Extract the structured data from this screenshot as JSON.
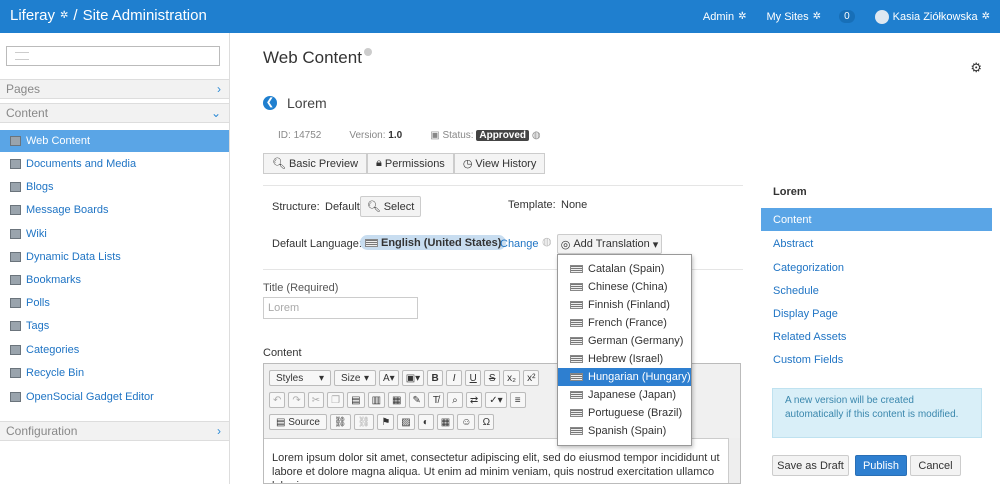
{
  "topbar": {
    "brand": "Liferay",
    "separator": "/",
    "section": "Site Administration",
    "admin": "Admin",
    "my_sites": "My Sites",
    "notifications": "0",
    "user": "Kasia Ziółkowska"
  },
  "sidebar": {
    "pages": "Pages",
    "content": "Content",
    "configuration": "Configuration",
    "items": [
      {
        "label": "Web Content"
      },
      {
        "label": "Documents and Media"
      },
      {
        "label": "Blogs"
      },
      {
        "label": "Message Boards"
      },
      {
        "label": "Wiki"
      },
      {
        "label": "Dynamic Data Lists"
      },
      {
        "label": "Bookmarks"
      },
      {
        "label": "Polls"
      },
      {
        "label": "Tags"
      },
      {
        "label": "Categories"
      },
      {
        "label": "Recycle Bin"
      },
      {
        "label": "OpenSocial Gadget Editor"
      }
    ]
  },
  "main": {
    "page_title": "Web Content",
    "article_title": "Lorem",
    "id_label": "ID:",
    "id_value": "14752",
    "version_label": "Version:",
    "version_value": "1.0",
    "status_label": "Status:",
    "status_value": "Approved",
    "tabs": {
      "basic_preview": "Basic Preview",
      "permissions": "Permissions",
      "view_history": "View History"
    },
    "structure_label": "Structure:",
    "structure_value": "Default",
    "select_button": "Select",
    "template_label": "Template:",
    "template_value": "None",
    "default_language_label": "Default Language:",
    "default_language_value": "English (United States)",
    "change_link": "Change",
    "add_translation": "Add Translation",
    "title_label": "Title (Required)",
    "title_value": "Lorem",
    "content_label": "Content",
    "editor": {
      "styles": "Styles",
      "size": "Size",
      "source": "Source",
      "text_line1": "Lorem ipsum dolor sit amet, consectetur adipiscing elit, sed do eiusmod tempor incididunt ut",
      "text_line2": "labore et dolore magna aliqua. Ut enim ad minim veniam, quis nostrud exercitation ullamco laboris"
    },
    "translations": [
      {
        "label": "Catalan (Spain)"
      },
      {
        "label": "Chinese (China)"
      },
      {
        "label": "Finnish (Finland)"
      },
      {
        "label": "French (France)"
      },
      {
        "label": "German (Germany)"
      },
      {
        "label": "Hebrew (Israel)"
      },
      {
        "label": "Hungarian (Hungary)"
      },
      {
        "label": "Japanese (Japan)"
      },
      {
        "label": "Portuguese (Brazil)"
      },
      {
        "label": "Spanish (Spain)"
      }
    ],
    "selected_translation": "Hungarian (Hungary)"
  },
  "right_panel": {
    "title": "Lorem",
    "items": [
      {
        "label": "Content"
      },
      {
        "label": "Abstract"
      },
      {
        "label": "Categorization"
      },
      {
        "label": "Schedule"
      },
      {
        "label": "Display Page"
      },
      {
        "label": "Related Assets"
      },
      {
        "label": "Custom Fields"
      }
    ],
    "note": "A new version will be created automatically if this content is modified.",
    "save_as_draft": "Save as Draft",
    "publish": "Publish",
    "cancel": "Cancel"
  },
  "colors": {
    "topbar": "#1f7fcf",
    "active_item": "#5aa5e6",
    "link": "#1f74c4",
    "primary_button": "#2e7fd0",
    "info_box": "#d9eff8"
  }
}
